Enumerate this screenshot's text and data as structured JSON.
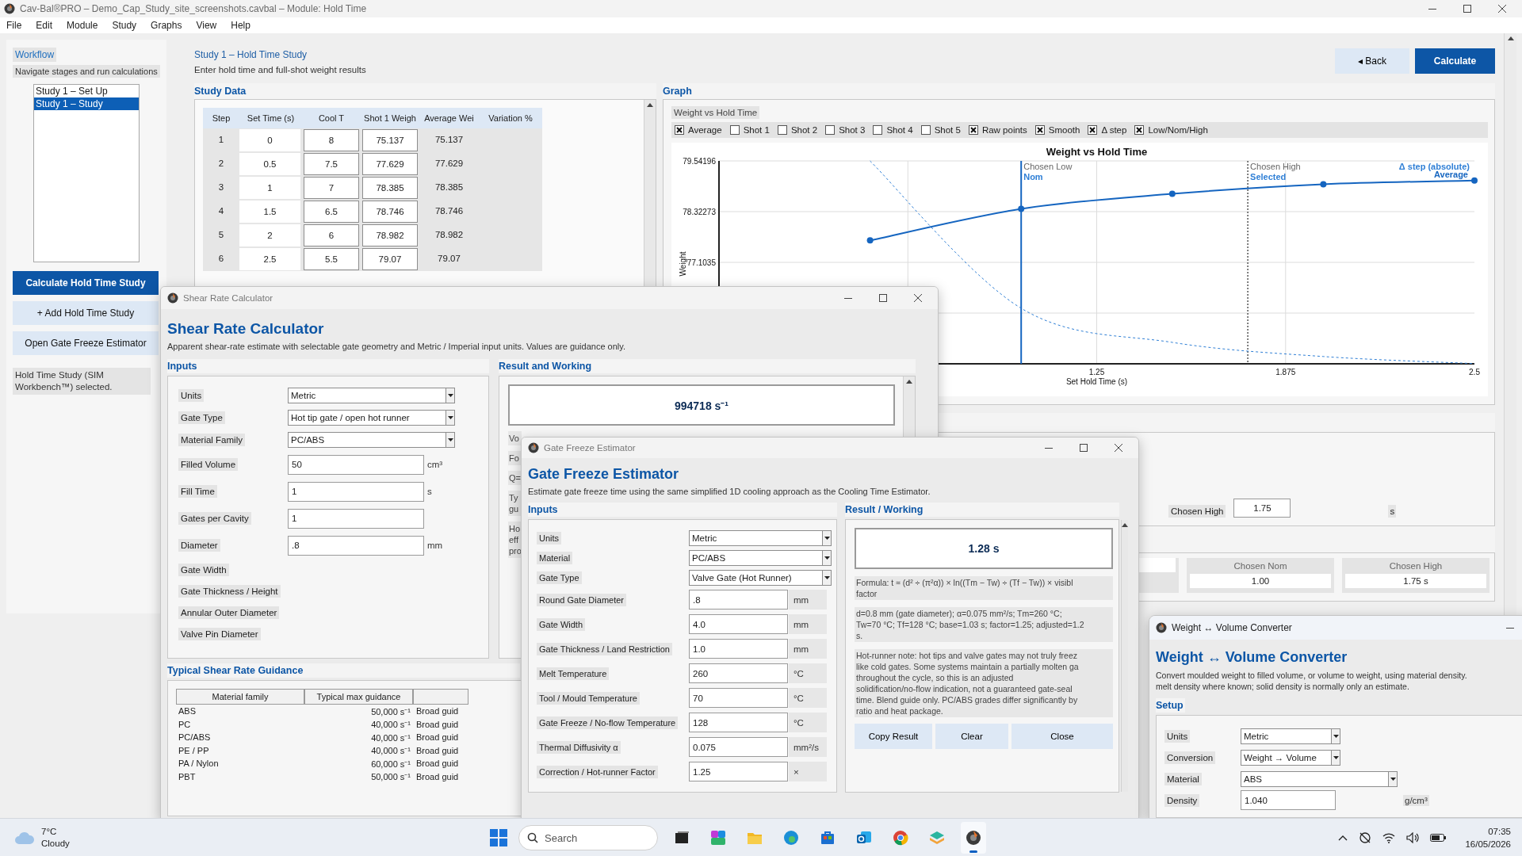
{
  "window": {
    "title": "Cav-Bal®PRO – Demo_Cap_Study_site_screenshots.cavbal – Module: Hold Time"
  },
  "menu": [
    "File",
    "Edit",
    "Module",
    "Study",
    "Graphs",
    "View",
    "Help"
  ],
  "sidebar": {
    "title": "Workflow",
    "subtitle": "Navigate stages and run calculations",
    "stages": [
      {
        "label": "Study 1 – Set Up",
        "selected": false
      },
      {
        "label": "Study 1 – Study",
        "selected": true
      }
    ],
    "buttons": [
      {
        "label": "Calculate Hold Time Study",
        "kind": "primary"
      },
      {
        "label": "+ Add Hold Time Study",
        "kind": "secondary"
      },
      {
        "label": "Open Gate Freeze Estimator",
        "kind": "secondary"
      }
    ],
    "status": "Hold Time Study (SIM Workbench™) selected."
  },
  "header": {
    "title": "Study 1 – Hold Time Study",
    "subtitle": "Enter hold time and full-shot weight results",
    "buttons": [
      {
        "label": "◂ Back",
        "kind": "secondary"
      },
      {
        "label": "Calculate",
        "kind": "primary"
      }
    ]
  },
  "study_data": {
    "title": "Study Data",
    "columns": [
      {
        "label": "Step",
        "kind": "index"
      },
      {
        "label": "Set Time (s)",
        "kind": "white"
      },
      {
        "label": "Cool T",
        "kind": "input"
      },
      {
        "label": "Shot 1 Weigh",
        "kind": "input"
      },
      {
        "label": "Average Wei",
        "kind": "gray"
      },
      {
        "label": "Variation %",
        "kind": "gray"
      }
    ],
    "rows": [
      [
        "1",
        "0",
        "8",
        "75.137",
        "75.137"
      ],
      [
        "2",
        "0.5",
        "7.5",
        "77.629",
        "77.629"
      ],
      [
        "3",
        "1",
        "7",
        "78.385",
        "78.385"
      ],
      [
        "4",
        "1.5",
        "6.5",
        "78.746",
        "78.746"
      ],
      [
        "5",
        "2",
        "6",
        "78.982",
        "78.982"
      ],
      [
        "6",
        "2.5",
        "5.5",
        "79.07",
        "79.07"
      ]
    ]
  },
  "graph": {
    "title": "Graph",
    "chart_label": "Weight vs Hold Time",
    "toggles": [
      {
        "label": "Average",
        "checked": true
      },
      {
        "label": "Shot 1",
        "checked": false
      },
      {
        "label": "Shot 2",
        "checked": false
      },
      {
        "label": "Shot 3",
        "checked": false
      },
      {
        "label": "Shot 4",
        "checked": false
      },
      {
        "label": "Shot 5",
        "checked": false
      },
      {
        "label": "Raw points",
        "checked": true
      },
      {
        "label": "Smooth",
        "checked": true
      },
      {
        "label": "Δ step",
        "checked": true
      },
      {
        "label": "Low/Nom/High",
        "checked": true
      }
    ],
    "chart_data": {
      "type": "line",
      "title": "Weight vs Hold Time",
      "xlabel": "Set Hold Time (s)",
      "ylabel": "Weight",
      "x": [
        0.5,
        1,
        1.5,
        2,
        2.5
      ],
      "series": [
        {
          "name": "Average",
          "color": "#1565c0",
          "values": [
            77.63,
            78.39,
            78.75,
            78.98,
            79.07
          ],
          "marker": "circle"
        },
        {
          "name": "Δ step (absolute)",
          "color": "#2f7fd6",
          "line_style": "dashed",
          "values": [
            79.54,
            76.0,
            75.18,
            74.84,
            74.67
          ]
        }
      ],
      "xlim": [
        0,
        2.5
      ],
      "ylim": [
        74.66504,
        79.54196
      ],
      "xticks": [
        1.25,
        1.875,
        2.5
      ],
      "yticks": [
        77.1035,
        78.32273,
        79.54196
      ],
      "grid": true,
      "ref_lines": [
        {
          "axis": "x",
          "value": 1
        },
        {
          "axis": "x",
          "value": 1.75
        }
      ],
      "annotations": [
        "Nom",
        "Chosen Low",
        "Chosen High",
        "Selected"
      ]
    }
  },
  "limits": {
    "label": "Chosen High",
    "value": "1.75",
    "unit": "s"
  },
  "summary": [
    {
      "label": "Chosen Nom",
      "value": "1.00"
    },
    {
      "label": "Chosen High",
      "value": "1.75 s"
    }
  ],
  "shear": {
    "title": "Shear Rate Calculator",
    "heading": "Shear Rate Calculator",
    "subtitle": "Apparent shear-rate estimate with selectable gate geometry and Metric / Imperial input units. Values are guidance only.",
    "inputs": {
      "title": "Inputs",
      "rows": [
        {
          "label": "Units",
          "kind": "combo",
          "value": "Metric"
        },
        {
          "label": "Gate Type",
          "kind": "combo",
          "value": "Hot tip gate / open hot runner"
        },
        {
          "label": "Material Family",
          "kind": "combo",
          "value": "PC/ABS"
        },
        {
          "label": "Filled Volume",
          "kind": "input",
          "value": "50",
          "unit": "cm³"
        },
        {
          "label": "Fill Time",
          "kind": "input",
          "value": "1",
          "unit": "s"
        },
        {
          "label": "Gates per Cavity",
          "kind": "input",
          "value": "1"
        },
        {
          "label": "Diameter",
          "kind": "input",
          "value": ".8",
          "unit": "mm"
        },
        {
          "label": "Gate Width",
          "kind": "label"
        },
        {
          "label": "Gate Thickness / Height",
          "kind": "label"
        },
        {
          "label": "Annular Outer Diameter",
          "kind": "label"
        },
        {
          "label": "Valve Pin Diameter",
          "kind": "label"
        }
      ]
    },
    "result": {
      "title": "Result and Working",
      "value": "994718 s⁻¹",
      "notes": [
        [
          "Vo"
        ],
        [
          "Fo"
        ],
        [
          "Q="
        ],
        [
          "Ty",
          "gu"
        ],
        [
          "Ho",
          "eff",
          "pro"
        ]
      ]
    },
    "guidance": {
      "title": "Typical Shear Rate Guidance",
      "columns": [
        "Material family",
        "Typical max guidance"
      ],
      "rows": [
        [
          "ABS",
          "50,000 s⁻¹",
          "Broad guid"
        ],
        [
          "PC",
          "40,000 s⁻¹",
          "Broad guid"
        ],
        [
          "PC/ABS",
          "40,000 s⁻¹",
          "Broad guid"
        ],
        [
          "PE / PP",
          "40,000 s⁻¹",
          "Broad guid"
        ],
        [
          "PA / Nylon",
          "60,000 s⁻¹",
          "Broad guid"
        ],
        [
          "PBT",
          "50,000 s⁻¹",
          "Broad guid"
        ]
      ]
    }
  },
  "gate": {
    "title": "Gate Freeze Estimator",
    "heading": "Gate Freeze Estimator",
    "subtitle": "Estimate gate freeze time using the same simplified 1D cooling approach as the Cooling Time Estimator.",
    "inputs": {
      "title": "Inputs",
      "rows": [
        {
          "label": "Units",
          "kind": "combo",
          "value": "Metric"
        },
        {
          "label": "Material",
          "kind": "combo",
          "value": "PC/ABS"
        },
        {
          "label": "Gate Type",
          "kind": "combo",
          "value": "Valve Gate (Hot Runner)"
        },
        {
          "label": "Round Gate Diameter",
          "kind": "input",
          "value": ".8",
          "unit": "mm"
        },
        {
          "label": "Gate Width",
          "kind": "input",
          "value": "4.0",
          "unit": "mm"
        },
        {
          "label": "Gate Thickness / Land Restriction",
          "kind": "input",
          "value": "1.0",
          "unit": "mm"
        },
        {
          "label": "Melt Temperature",
          "kind": "input",
          "value": "260",
          "unit": "°C"
        },
        {
          "label": "Tool / Mould Temperature",
          "kind": "input",
          "value": "70",
          "unit": "°C"
        },
        {
          "label": "Gate Freeze / No-flow Temperature",
          "kind": "input",
          "value": "128",
          "unit": "°C"
        },
        {
          "label": "Thermal Diffusivity α",
          "kind": "input",
          "value": "0.075",
          "unit": "mm²/s"
        },
        {
          "label": "Correction / Hot-runner Factor",
          "kind": "input",
          "value": "1.25",
          "unit": "×"
        }
      ]
    },
    "result": {
      "title": "Result / Working",
      "value": "1.28 s",
      "notes": [
        [
          "Formula: t ≈ (d² ÷ (π²α)) × ln((Tm − Tw) ÷ (Tf − Tw)) × visibl",
          "factor"
        ],
        [
          "d=0.8 mm (gate diameter); α=0.075 mm²/s; Tm=260 °C;",
          "Tw=70 °C; Tf=128 °C; base=1.03 s; factor=1.25; adjusted=1.2",
          "s."
        ],
        [
          "Hot-runner note: hot tips and valve gates may not truly freez",
          "like cold gates. Some systems maintain a partially molten ga",
          "throughout the cycle, so this is an adjusted",
          "solidification/no-flow indication, not a guaranteed gate-seal",
          "time. Blend guide only. PC/ABS grades differ significantly by",
          "ratio and heat package."
        ]
      ]
    },
    "buttons": [
      "Copy Result",
      "Clear",
      "Close"
    ]
  },
  "converter": {
    "title": "Weight ↔ Volume Converter",
    "heading": "Weight ↔ Volume Converter",
    "subtitle": [
      "Convert moulded weight to filled volume, or volume to weight, using material density.",
      "melt density where known; solid density is normally only an estimate."
    ],
    "setup": {
      "title": "Setup",
      "rows": [
        {
          "label": "Units",
          "kind": "combo",
          "value": "Metric"
        },
        {
          "label": "Conversion",
          "kind": "combo",
          "value": "Weight → Volume"
        },
        {
          "label": "Material",
          "kind": "wide_combo",
          "value": "ABS"
        },
        {
          "label": "Density",
          "kind": "input",
          "value": "1.040",
          "unit": "g/cm³"
        }
      ]
    }
  },
  "taskbar": {
    "weather": {
      "temp": "7°C",
      "condition": "Cloudy"
    },
    "search": {
      "placeholder": "Search"
    },
    "apps": [
      {
        "kind": "task_view",
        "active": false
      },
      {
        "kind": "copilot",
        "active": false
      },
      {
        "kind": "folder",
        "active": false
      },
      {
        "kind": "edge",
        "active": false
      },
      {
        "kind": "store",
        "active": false
      },
      {
        "kind": "mail",
        "active": false
      },
      {
        "kind": "chrome",
        "active": false
      },
      {
        "kind": "layers",
        "active": false
      },
      {
        "kind": "logo",
        "active": true
      }
    ],
    "time": "07:35",
    "date": "16/05/2026"
  }
}
